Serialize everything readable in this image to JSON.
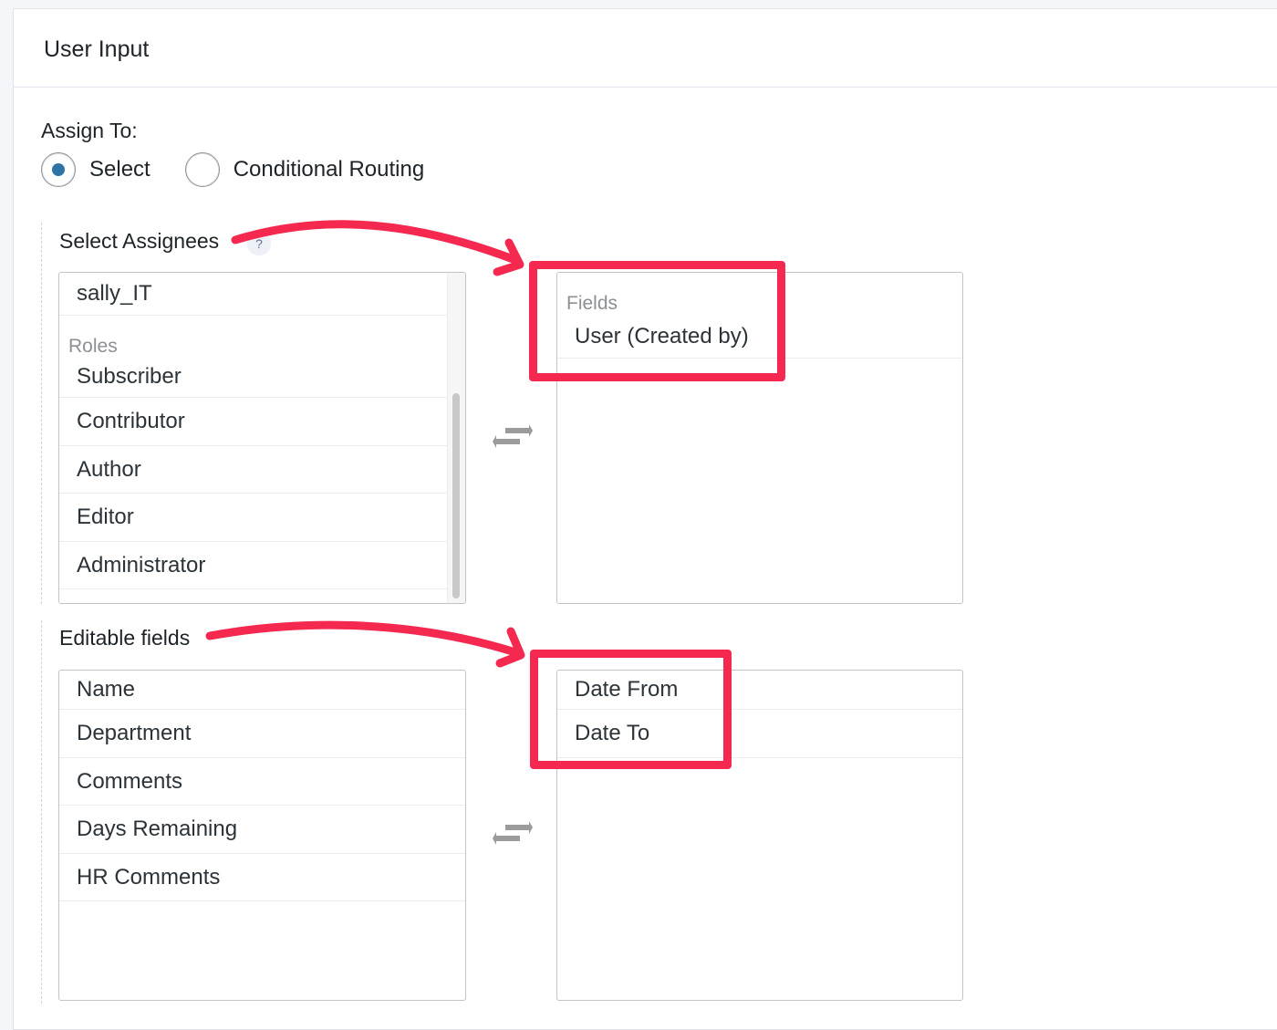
{
  "panel": {
    "title": "User Input"
  },
  "assign": {
    "label": "Assign To:",
    "options": [
      {
        "label": "Select",
        "checked": true
      },
      {
        "label": "Conditional Routing",
        "checked": false
      }
    ]
  },
  "assignees": {
    "title": "Select Assignees",
    "help": "?",
    "available": {
      "user_item": "sally_IT",
      "roles_group": "Roles",
      "roles": [
        "Subscriber",
        "Contributor",
        "Author",
        "Editor",
        "Administrator"
      ]
    },
    "selected": {
      "group": "Fields",
      "items": [
        "User (Created by)"
      ]
    }
  },
  "editable": {
    "title": "Editable fields",
    "available": [
      "Name",
      "Department",
      "Comments",
      "Days Remaining",
      "HR Comments"
    ],
    "selected": [
      "Date From",
      "Date To"
    ]
  },
  "colors": {
    "annotation": "#f5284f",
    "radio_accent": "#2e73a5"
  },
  "icons": {
    "swap": "swap-arrows-icon",
    "arrow": "annotation-arrow-icon"
  }
}
